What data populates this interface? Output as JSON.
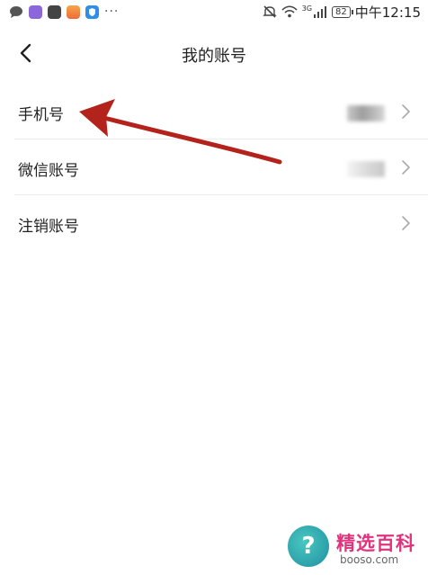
{
  "status_bar": {
    "overflow_dots": "···",
    "network_label": "3G",
    "battery": "82",
    "time": "中午12:15"
  },
  "header": {
    "title": "我的账号"
  },
  "rows": [
    {
      "label": "手机号"
    },
    {
      "label": "微信账号"
    },
    {
      "label": "注销账号"
    }
  ],
  "watermark": {
    "logo_glyph": "?",
    "brand": "精选百科",
    "url": "booso.com"
  },
  "colors": {
    "annotation_arrow": "#b3231b",
    "watermark_brand": "#e0337e"
  },
  "icons": {
    "back": "chevron-left-icon",
    "row_arrow": "chevron-right-icon"
  }
}
